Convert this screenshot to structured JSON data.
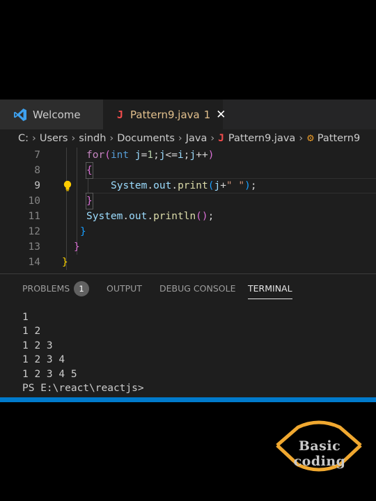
{
  "tabs": [
    {
      "label": "Welcome",
      "icon": "vscode-icon"
    },
    {
      "icon_letter": "J",
      "label": "Pattern9.java",
      "modified_count": "1",
      "close": "✕"
    }
  ],
  "breadcrumb": {
    "items": [
      "C:",
      "Users",
      "sindh",
      "Documents",
      "Java",
      "Pattern9.java",
      "Pattern9"
    ],
    "java_icon_letter": "J",
    "class_icon": "class-icon"
  },
  "editor": {
    "line_numbers": [
      "7",
      "8",
      "9",
      "10",
      "11",
      "12",
      "13",
      "14"
    ],
    "current_line": "9",
    "lines": [
      "for(int j=1;j<=i;j++)",
      "{",
      "System.out.print(j+\" \");",
      "}",
      "System.out.println();",
      "}",
      "}",
      "}"
    ]
  },
  "panel": {
    "tabs": [
      "PROBLEMS",
      "OUTPUT",
      "DEBUG CONSOLE",
      "TERMINAL"
    ],
    "problems_count": "1",
    "active_tab": "TERMINAL"
  },
  "terminal": {
    "lines": [
      "1",
      "1 2",
      "1 2 3",
      "1 2 3 4",
      "1 2 3 4 5",
      "PS E:\\react\\reactjs>"
    ]
  },
  "watermark": {
    "text": "Basic coding"
  },
  "colors": {
    "editor_bg": "#1e1e1e",
    "status_bar": "#007acc",
    "keyword": "#c586c0",
    "type": "#569cd6",
    "string": "#ce9178",
    "function": "#dcdcaa"
  }
}
